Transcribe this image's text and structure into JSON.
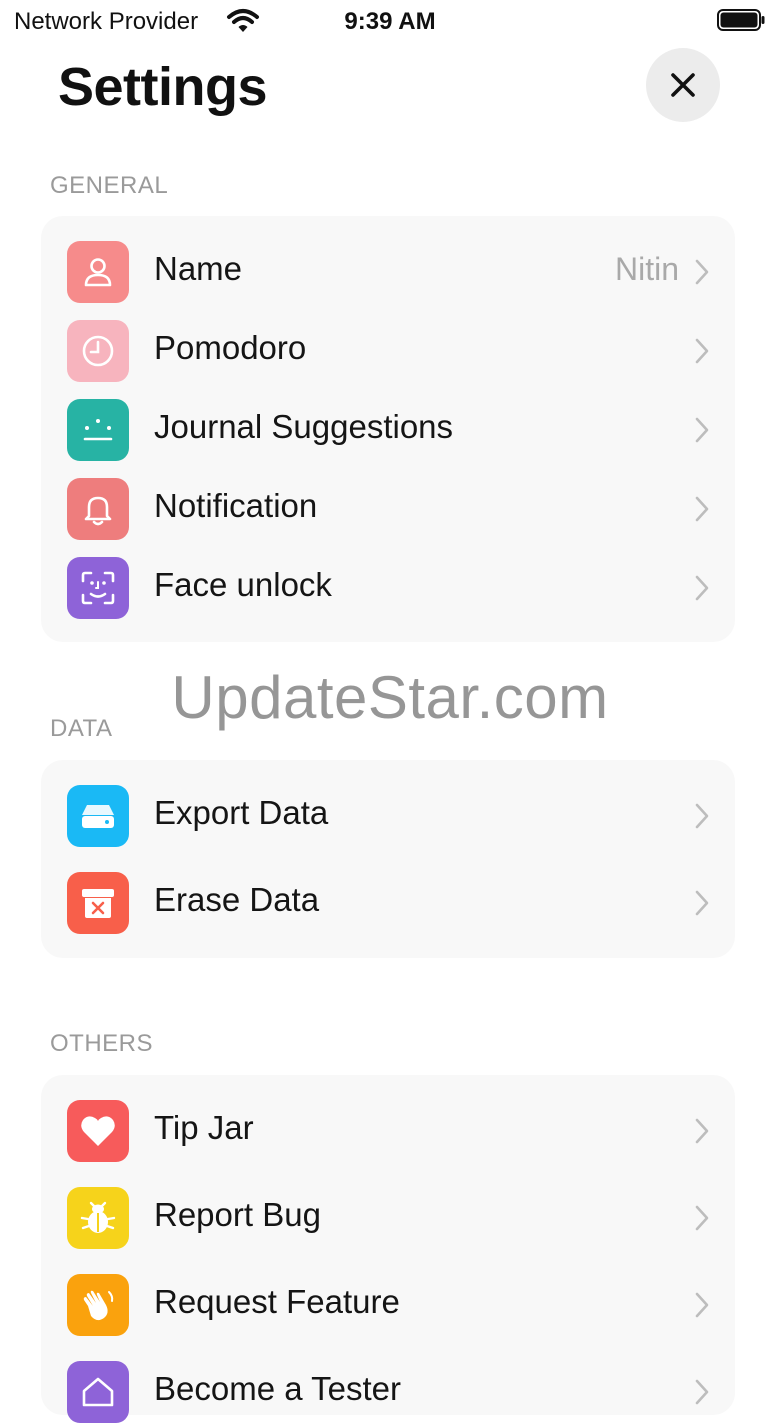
{
  "status_bar": {
    "carrier": "Network Provider",
    "time": "9:39 AM"
  },
  "header": {
    "title": "Settings"
  },
  "sections": {
    "general": {
      "title": "GENERAL",
      "rows": [
        {
          "label": "Name",
          "value": "Nitin",
          "icon": "person-icon",
          "color": "#f68b8b"
        },
        {
          "label": "Pomodoro",
          "value": "",
          "icon": "clock-icon",
          "color": "#f7b4be"
        },
        {
          "label": "Journal Suggestions",
          "value": "",
          "icon": "smile-icon",
          "color": "#27b3a4"
        },
        {
          "label": "Notification",
          "value": "",
          "icon": "bell-icon",
          "color": "#ee7d7d"
        },
        {
          "label": "Face unlock",
          "value": "",
          "icon": "face-id-icon",
          "color": "#8e63d8"
        }
      ]
    },
    "data": {
      "title": "DATA",
      "rows": [
        {
          "label": "Export Data",
          "icon": "drive-icon",
          "color": "#1ab9f5"
        },
        {
          "label": "Erase Data",
          "icon": "trash-box-icon",
          "color": "#f85f4a"
        }
      ]
    },
    "others": {
      "title": "OTHERS",
      "rows": [
        {
          "label": "Tip Jar",
          "icon": "heart-icon",
          "color": "#f75b5b"
        },
        {
          "label": "Report Bug",
          "icon": "bug-icon",
          "color": "#f6d31b"
        },
        {
          "label": "Request Feature",
          "icon": "hand-wave-icon",
          "color": "#faa20d"
        },
        {
          "label": "Become a Tester",
          "icon": "house-icon",
          "color": "#8e63d8"
        }
      ]
    }
  },
  "watermark": "UpdateStar.com"
}
